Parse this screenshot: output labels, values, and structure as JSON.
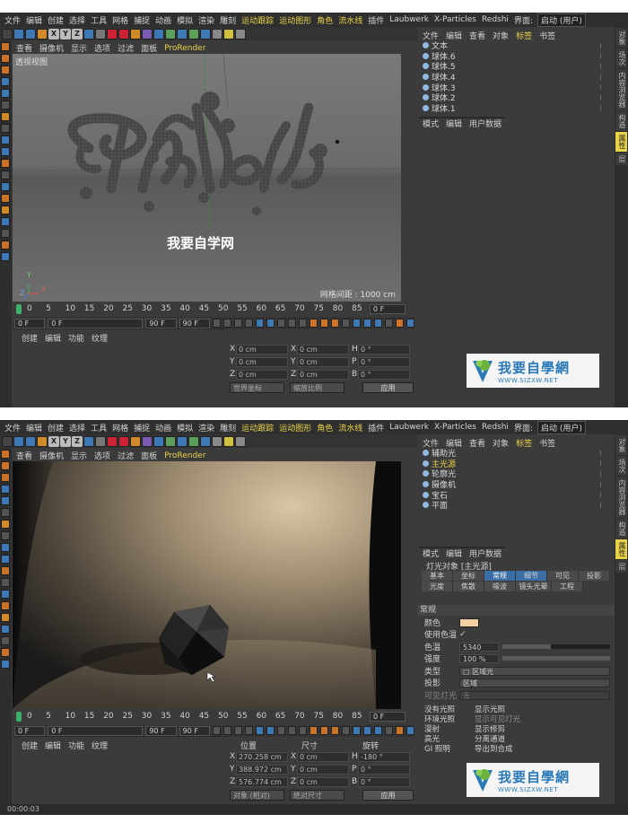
{
  "colors": {
    "accent_yellow": "#e8d24a",
    "tab_blue": "#3a6ea5",
    "color_swatch": "#f3cfa4"
  },
  "menu": [
    "文件",
    "编辑",
    "创建",
    "选择",
    "工具",
    "网格",
    "捕捉",
    "动画",
    "模拟",
    "渲染",
    "雕刻",
    "运动跟踪",
    "运动图形",
    "角色",
    "流水线",
    "插件",
    "Laubwerk",
    "X-Particles",
    "Redshi"
  ],
  "menu_layout_label": "界面:",
  "menu_layout_value": "启动 (用户)",
  "toolbar_letters": [
    "X",
    "Y",
    "Z"
  ],
  "viewport_menu": [
    "查看",
    "摄像机",
    "显示",
    "选项",
    "过滤",
    "面板"
  ],
  "viewport_menu_pr": "ProRender",
  "top": {
    "viewport_label": "透视视图",
    "watermark_text": "我要自学网",
    "grid_label": "网格间距 : 1000 cm",
    "axis_y": "Y",
    "axis_x": "X",
    "axis_z": "Z",
    "objects": [
      "文本",
      "球体.6",
      "球体.5",
      "球体.4",
      "球体.3",
      "球体.2",
      "球体.1"
    ],
    "attr_menu": [
      "模式",
      "编辑",
      "用户数据"
    ],
    "coord_header": [
      "",
      "",
      ""
    ],
    "coord_rows": [
      {
        "a": "X",
        "v1": "0 cm",
        "b": "X",
        "v2": "0 cm",
        "c": "H",
        "v3": "0 °"
      },
      {
        "a": "Y",
        "v1": "0 cm",
        "b": "Y",
        "v2": "0 cm",
        "c": "P",
        "v3": "0 °"
      },
      {
        "a": "Z",
        "v1": "0 cm",
        "b": "Z",
        "v2": "0 cm",
        "c": "B",
        "v3": "0 °"
      }
    ],
    "coord_dd1": "世界坐标",
    "coord_dd2": "缩放比例",
    "coord_apply": "应用"
  },
  "bottom": {
    "objects": [
      "辅助光",
      "主光源",
      "轮廓光",
      "摄像机",
      "宝石",
      "平面"
    ],
    "attr_menu": [
      "模式",
      "编辑",
      "用户数据"
    ],
    "light_title": "灯光对象 [主光源]",
    "light_tabs": [
      "基本",
      "坐标",
      "常规",
      "细节",
      "可见",
      "投影",
      "光度",
      "焦散",
      "噪波",
      "镜头光晕",
      "工程"
    ],
    "section": "常规",
    "color_label": "颜色",
    "use_temp_label": "使用色温",
    "temp_label": "色温",
    "temp_value": "5340",
    "temp_fraction": 0.45,
    "intensity_label": "强度",
    "intensity_value": "100 %",
    "intensity_fraction": 1.0,
    "type_label": "类型",
    "type_value": "区域光",
    "shadow_label": "投影",
    "shadow_value": "区域",
    "visible_label": "可见灯光",
    "visible_value": "无",
    "checks": [
      [
        "没有光照",
        "显示光照"
      ],
      [
        "环境光照",
        "显示可见灯光"
      ],
      [
        "漫射",
        "显示修剪"
      ],
      [
        "高光",
        "分离通道"
      ],
      [
        "GI 照明",
        "导出到合成"
      ]
    ],
    "coord_header": [
      "位置",
      "尺寸",
      "旋转"
    ],
    "coord_rows": [
      {
        "a": "X",
        "v1": "270.258 cm",
        "b": "X",
        "v2": "0 cm",
        "c": "H",
        "v3": "-180 °"
      },
      {
        "a": "Y",
        "v1": "388.972 cm",
        "b": "Y",
        "v2": "0 cm",
        "c": "P",
        "v3": "0 °"
      },
      {
        "a": "Z",
        "v1": "576.774 cm",
        "b": "Z",
        "v2": "0 cm",
        "c": "B",
        "v3": "0 °"
      }
    ],
    "coord_dd1": "对象 (相对)",
    "coord_dd2": "绝对尺寸",
    "coord_apply": "应用",
    "status_time": "00:00:03"
  },
  "timeline_ticks": [
    "0",
    "5",
    "10",
    "15",
    "20",
    "25",
    "30",
    "35",
    "40",
    "45",
    "50",
    "55",
    "60",
    "65",
    "70",
    "75",
    "80",
    "85",
    "90"
  ],
  "frame_start": "0 F",
  "frame_cur": "0 F",
  "frame_end": "90 F",
  "frame_end2": "90 F",
  "frame_right": "0 F",
  "mat_menu": [
    "创建",
    "编辑",
    "功能",
    "纹理"
  ],
  "right_tabs": [
    "对象",
    "场次",
    "内容浏览器",
    "构造",
    "属性",
    "层"
  ],
  "logo": {
    "cn": "我要自學網",
    "url": "WWW.SIZXW.NET"
  }
}
